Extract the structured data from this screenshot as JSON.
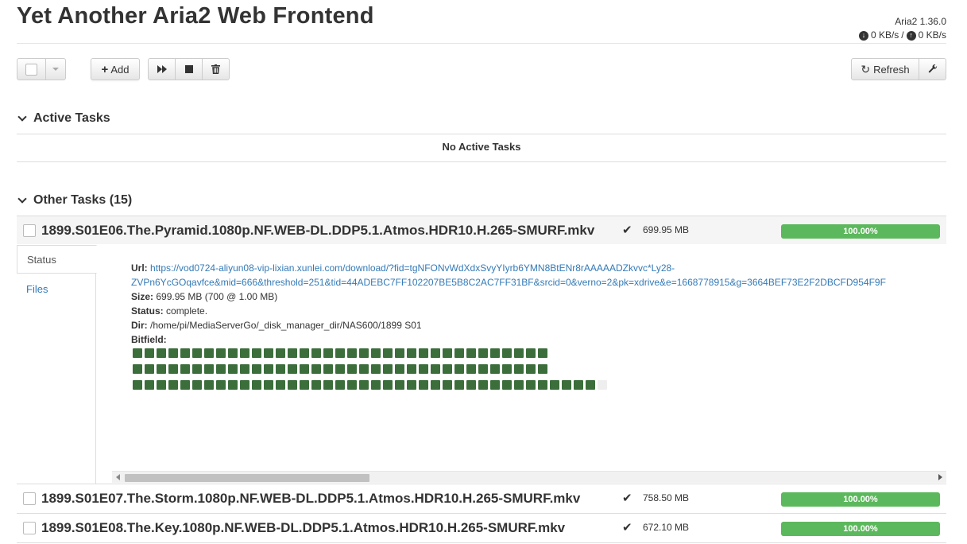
{
  "app": {
    "title": "Yet Another Aria2 Web Frontend",
    "version": "Aria2 1.36.0",
    "download_speed": "0 KB/s",
    "speed_separator": "/",
    "upload_speed": "0 KB/s",
    "download_icon": "download-speed-icon",
    "upload_icon": "upload-speed-icon"
  },
  "toolbar": {
    "add_label": "Add",
    "refresh_label": "Refresh",
    "icons": [
      "select-all-checkbox",
      "dropdown-caret-icon",
      "plus-icon",
      "resume-icon",
      "stop-icon",
      "trash-icon",
      "refresh-icon",
      "wrench-icon"
    ]
  },
  "active_section": {
    "heading": "Active Tasks",
    "empty_text": "No Active Tasks"
  },
  "other_section": {
    "heading": "Other Tasks (15)"
  },
  "tasks": [
    {
      "name": "1899.S01E06.The.Pyramid.1080p.NF.WEB-DL.DDP5.1.Atmos.HDR10.H.265-SMURF.mkv",
      "size": "699.95 MB",
      "progress": "100.00%",
      "progress_value": 100
    },
    {
      "name": "1899.S01E07.The.Storm.1080p.NF.WEB-DL.DDP5.1.Atmos.HDR10.H.265-SMURF.mkv",
      "size": "758.50 MB",
      "progress": "100.00%",
      "progress_value": 100
    },
    {
      "name": "1899.S01E08.The.Key.1080p.NF.WEB-DL.DDP5.1.Atmos.HDR10.H.265-SMURF.mkv",
      "size": "672.10 MB",
      "progress": "100.00%",
      "progress_value": 100
    }
  ],
  "detail": {
    "tabs": [
      "Status",
      "Files"
    ],
    "url_label": "Url:",
    "url_line1": "https://vod0724-aliyun08-vip-lixian.xunlei.com/download/?fid=tgNFONvWdXdxSvyYIyrb6YMN8BtENr8rAAAAADZkvvc*Ly28-",
    "url_line2": "ZVPn6YcGOqavfce&mid=666&threshold=251&tid=44ADEBC7FF102207BE5B8C2AC7FF31BF&srcid=0&verno=2&pk=xdrive&e=1668778915&g=3664BEF73E2F2DBCFD954F9F",
    "size_label": "Size:",
    "size_value": "699.95 MB (700 @ 1.00 MB)",
    "status_label": "Status:",
    "status_value": "complete.",
    "dir_label": "Dir:",
    "dir_value": "/home/pi/MediaServerGo/_disk_manager_dir/NAS600/1899 S01",
    "bitfield_label": "Bitfield:",
    "bitfield": {
      "rows": [
        {
          "filled": 35,
          "empty": 0
        },
        {
          "filled": 35,
          "empty": 0
        },
        {
          "filled": 39,
          "empty": 1
        }
      ]
    }
  }
}
